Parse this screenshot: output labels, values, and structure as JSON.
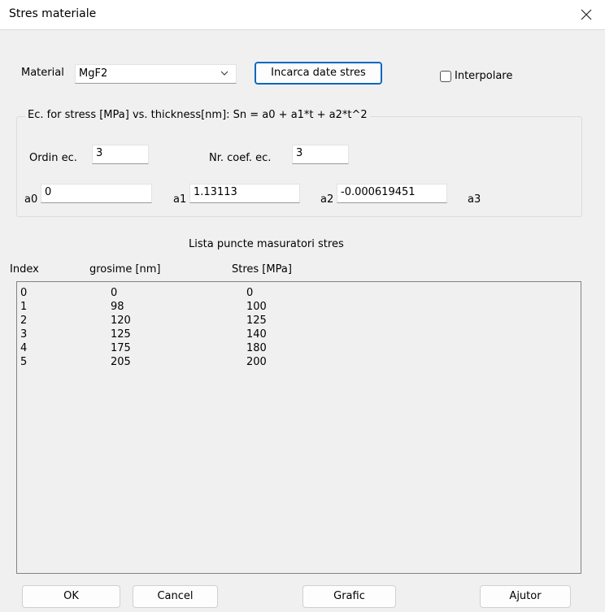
{
  "window": {
    "title": "Stres materiale"
  },
  "material": {
    "label": "Material",
    "selected": "MgF2",
    "load_button": "Incarca date stres",
    "interpolate_label": "Interpolare",
    "interpolate_checked": false
  },
  "equation": {
    "legend": "Ec. for stress [MPa] vs. thickness[nm]: Sn = a0 + a1*t + a2*t^2",
    "order_label": "Ordin ec.",
    "order_value": "3",
    "ncoef_label": "Nr. coef. ec.",
    "ncoef_value": "3",
    "a0_label": "a0",
    "a0_value": "0",
    "a1_label": "a1",
    "a1_value": "1.13113",
    "a2_label": "a2",
    "a2_value": "-0.000619451",
    "a3_label": "a3"
  },
  "list": {
    "title": "Lista puncte masuratori stres",
    "columns": [
      "Index",
      "grosime [nm]",
      "Stres [MPa]"
    ],
    "rows": [
      [
        "0",
        "0",
        "0"
      ],
      [
        "1",
        "98",
        "100"
      ],
      [
        "2",
        "120",
        "125"
      ],
      [
        "3",
        "125",
        "140"
      ],
      [
        "4",
        "175",
        "180"
      ],
      [
        "5",
        "205",
        "200"
      ]
    ]
  },
  "buttons": {
    "ok": "OK",
    "cancel": "Cancel",
    "chart": "Grafic",
    "help": "Ajutor"
  }
}
